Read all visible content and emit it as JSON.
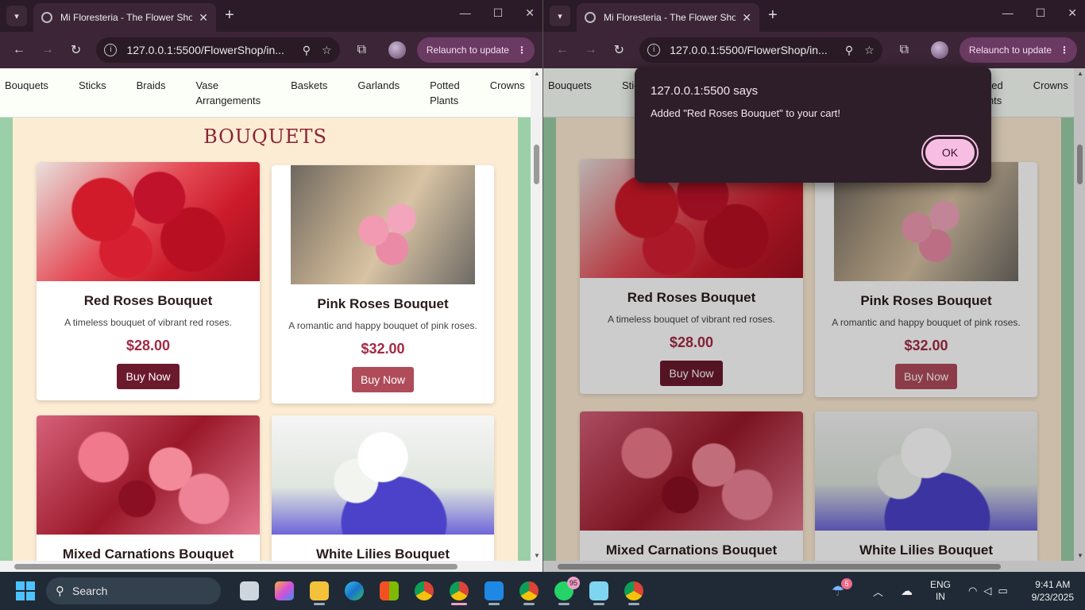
{
  "browser": {
    "tab_title": "Mi Floresteria - The Flower Shop",
    "url": "127.0.0.1:5500/FlowerShop/in...",
    "relaunch_label": "Relaunch to update"
  },
  "site": {
    "nav": [
      "Bouquets",
      "Sticks",
      "Braids",
      "Vase Arrangements",
      "Baskets",
      "Garlands",
      "Potted Plants",
      "Crowns"
    ],
    "section_title": "BOUQUETS",
    "products": [
      {
        "name": "Red Roses Bouquet",
        "desc": "A timeless bouquet of vibrant red roses.",
        "price": "$28.00",
        "button": "Buy Now"
      },
      {
        "name": "Pink Roses Bouquet",
        "desc": "A romantic and happy bouquet of pink roses.",
        "price": "$32.00",
        "button": "Buy Now"
      },
      {
        "name": "Mixed Carnations Bouquet"
      },
      {
        "name": "White Lilies Bouquet"
      }
    ]
  },
  "dialog": {
    "title": "127.0.0.1:5500 says",
    "message": "Added \"Red Roses Bouquet\" to your cart!",
    "ok_label": "OK"
  },
  "taskbar": {
    "search_label": "Search",
    "whatsapp_badge": "95",
    "weather_badge": "5",
    "lang_line1": "ENG",
    "lang_line2": "IN",
    "time": "9:41 AM",
    "date": "9/23/2025"
  }
}
